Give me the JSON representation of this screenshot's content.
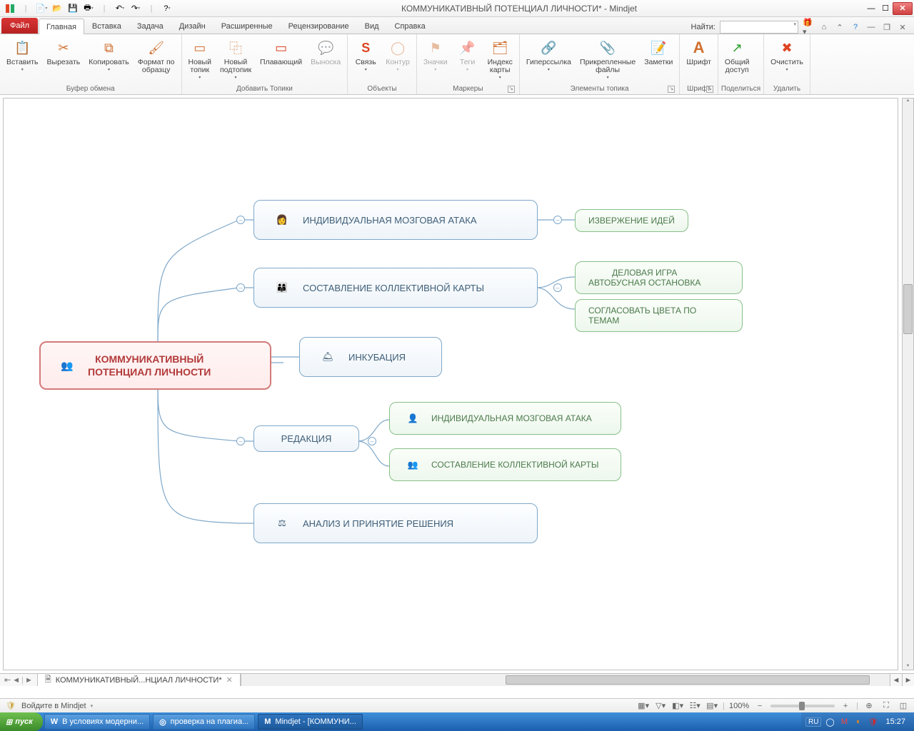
{
  "title": "КОММУНИКАТИВНЫЙ ПОТЕНЦИАЛ ЛИЧНОСТИ* - Mindjet",
  "tabs": {
    "file": "Файл",
    "items": [
      "Главная",
      "Вставка",
      "Задача",
      "Дизайн",
      "Расширенные",
      "Рецензирование",
      "Вид",
      "Справка"
    ],
    "active_index": 0
  },
  "find_label": "Найти:",
  "ribbon": {
    "groups": [
      {
        "label": "Буфер обмена",
        "buttons": [
          {
            "label": "Вставить",
            "drop": true,
            "icon": "📋"
          },
          {
            "label": "Вырезать",
            "icon": "✂"
          },
          {
            "label": "Копировать",
            "drop": true,
            "icon": "⧉"
          },
          {
            "label": "Формат по\nобразцу",
            "icon": "🖌"
          }
        ]
      },
      {
        "label": "Добавить Топики",
        "buttons": [
          {
            "label": "Новый\nтопик",
            "drop": true,
            "icon": "▭"
          },
          {
            "label": "Новый\nподтопик",
            "drop": true,
            "icon": "⿻"
          },
          {
            "label": "Плавающий",
            "icon": "▭",
            "color": "#d42"
          },
          {
            "label": "Выноска",
            "disabled": true,
            "icon": "💬"
          }
        ]
      },
      {
        "label": "Объекты",
        "buttons": [
          {
            "label": "Связь",
            "drop": true,
            "icon": "S",
            "color": "#d42",
            "bold": true
          },
          {
            "label": "Контур",
            "drop": true,
            "disabled": true,
            "icon": "◯"
          }
        ]
      },
      {
        "label": "Маркеры",
        "dlg": true,
        "buttons": [
          {
            "label": "Значки",
            "drop": true,
            "disabled": true,
            "icon": "⚑"
          },
          {
            "label": "Теги",
            "drop": true,
            "disabled": true,
            "icon": "📌"
          },
          {
            "label": "Индекс\nкарты",
            "drop": true,
            "icon": "🗂"
          }
        ]
      },
      {
        "label": "Элементы топика",
        "dlg": true,
        "buttons": [
          {
            "label": "Гиперссылка",
            "drop": true,
            "icon": "🔗"
          },
          {
            "label": "Прикрепленные\nфайлы",
            "drop": true,
            "icon": "📎"
          },
          {
            "label": "Заметки",
            "icon": "📝"
          }
        ]
      },
      {
        "label": "Шрифт",
        "dlg": true,
        "buttons": [
          {
            "label": "Шрифт",
            "icon": "A",
            "bold": true,
            "big": true
          }
        ]
      },
      {
        "label": "Поделиться",
        "buttons": [
          {
            "label": "Общий\nдоступ",
            "icon": "↗",
            "color": "#2a9d2a"
          }
        ]
      },
      {
        "label": "Удалить",
        "buttons": [
          {
            "label": "Очистить",
            "drop": true,
            "icon": "✖",
            "color": "#d42"
          }
        ]
      }
    ]
  },
  "mindmap": {
    "root": "КОММУНИКАТИВНЫЙ\nПОТЕНЦИАЛ ЛИЧНОСТИ",
    "b1": "ИНДИВИДУАЛЬНАЯ МОЗГОВАЯ АТАКА",
    "b1_1": "ИЗВЕРЖЕНИЕ ИДЕЙ",
    "b2": "СОСТАВЛЕНИЕ КОЛЛЕКТИВНОЙ КАРТЫ",
    "b2_1": "ДЕЛОВАЯ ИГРА\nАВТОБУСНАЯ ОСТАНОВКА",
    "b2_2": "СОГЛАСОВАТЬ ЦВЕТА ПО ТЕМАМ",
    "b3": "ИНКУБАЦИЯ",
    "b4": "РЕДАКЦИЯ",
    "b4_1": "ИНДИВИДУАЛЬНАЯ МОЗГОВАЯ АТАКА",
    "b4_2": "СОСТАВЛЕНИЕ КОЛЛЕКТИВНОЙ КАРТЫ",
    "b5": "АНАЛИЗ И ПРИНЯТИЕ РЕШЕНИЯ"
  },
  "doc_tab": "КОММУНИКАТИВНЫЙ...НЦИАЛ ЛИЧНОСТИ*",
  "status": {
    "login": "Войдите в Mindjet",
    "zoom": "100%"
  },
  "taskbar": {
    "start": "пуск",
    "items": [
      {
        "label": "В условиях модерни...",
        "icon": "W"
      },
      {
        "label": "проверка на плагиа...",
        "icon": "◎"
      },
      {
        "label": "Mindjet - [КОММУНИ...",
        "icon": "M",
        "active": true
      }
    ],
    "lang": "RU",
    "clock": "15:27"
  }
}
